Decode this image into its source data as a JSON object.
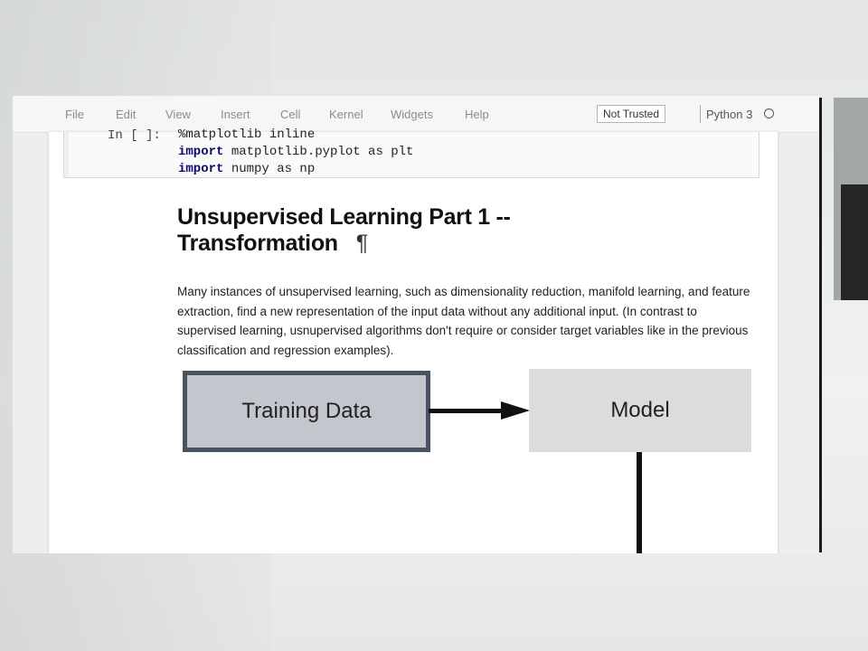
{
  "menubar": {
    "items": [
      "File",
      "Edit",
      "View",
      "Insert",
      "Cell",
      "Kernel",
      "Widgets",
      "Help"
    ],
    "trust_badge": "Not Trusted",
    "kernel_name": "Python 3",
    "kernel_status_icon": "circle-idle-icon"
  },
  "code_cell": {
    "prompt": "In [ ]:",
    "lines": [
      {
        "kw": "",
        "rest": "%matplotlib inline"
      },
      {
        "kw": "import",
        "rest": " matplotlib.pyplot as plt"
      },
      {
        "kw": "import",
        "rest": " numpy as np"
      }
    ]
  },
  "markdown": {
    "heading_line1": "Unsupervised Learning Part 1 --",
    "heading_line2": "Transformation",
    "anchor_symbol": "¶",
    "paragraph": "Many instances of unsupervised learning, such as dimensionality reduction, manifold learning, and feature extraction, find a new representation of the input data without any additional input. (In contrast to supervised learning, usnupervised algorithms don't require or consider target variables like in the previous classification and regression examples)."
  },
  "diagram": {
    "training_label": "Training Data",
    "model_label": "Model",
    "colors": {
      "training_fill": "#c3c7cd",
      "training_border": "#4a5460",
      "model_fill": "#dcdcdc",
      "arrow": "#111111"
    }
  }
}
